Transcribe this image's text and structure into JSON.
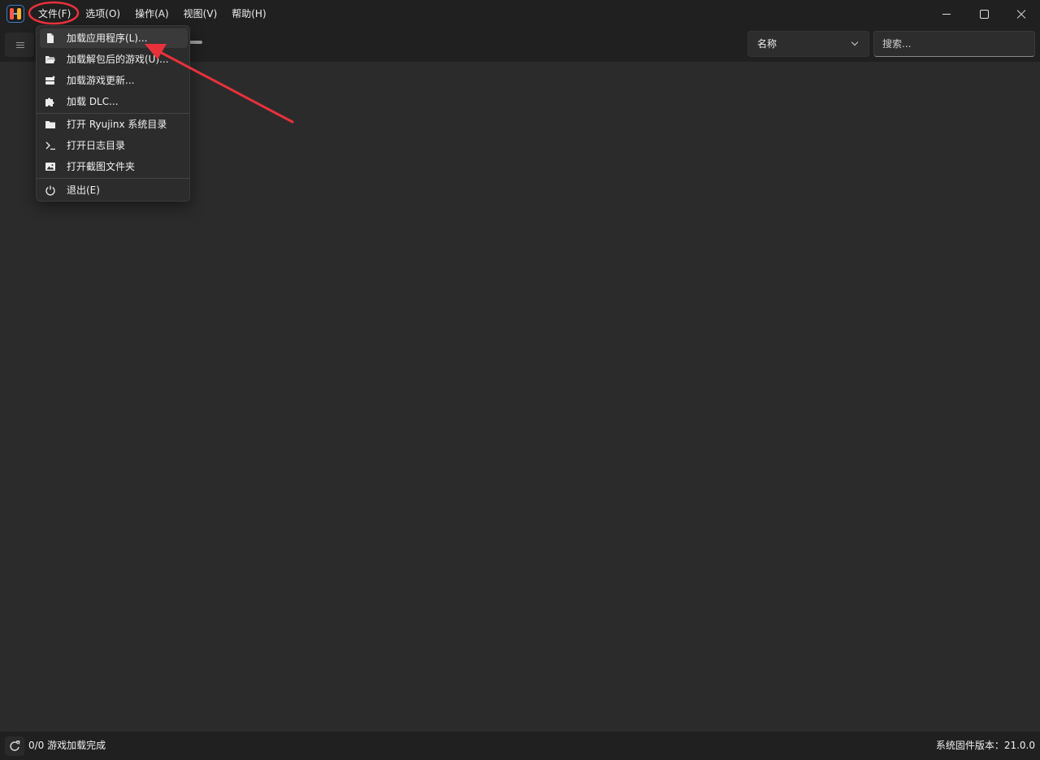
{
  "menubar": {
    "items": [
      {
        "label": "文件(F)"
      },
      {
        "label": "选项(O)"
      },
      {
        "label": "操作(A)"
      },
      {
        "label": "视图(V)"
      },
      {
        "label": "帮助(H)"
      }
    ]
  },
  "toolbar": {
    "sort_select_value": "名称",
    "search_placeholder": "搜索..."
  },
  "file_menu": {
    "items": [
      {
        "label": "加载应用程序(L)...",
        "icon": "file-icon"
      },
      {
        "label": "加载解包后的游戏(U)...",
        "icon": "folder-open-icon"
      },
      {
        "label": "加载游戏更新...",
        "icon": "update-icon"
      },
      {
        "label": "加载 DLC...",
        "icon": "puzzle-icon"
      },
      {
        "label": "打开 Ryujinx 系统目录",
        "icon": "folder-icon"
      },
      {
        "label": "打开日志目录",
        "icon": "terminal-icon"
      },
      {
        "label": "打开截图文件夹",
        "icon": "image-icon"
      },
      {
        "label": "退出(E)",
        "icon": "power-icon"
      }
    ]
  },
  "statusbar": {
    "games_loaded": "0/0 游戏加载完成",
    "firmware_version": "系统固件版本：21.0.0"
  },
  "colors": {
    "background": "#2b2b2b",
    "chrome": "#202020",
    "annotation": "#e8313b"
  }
}
